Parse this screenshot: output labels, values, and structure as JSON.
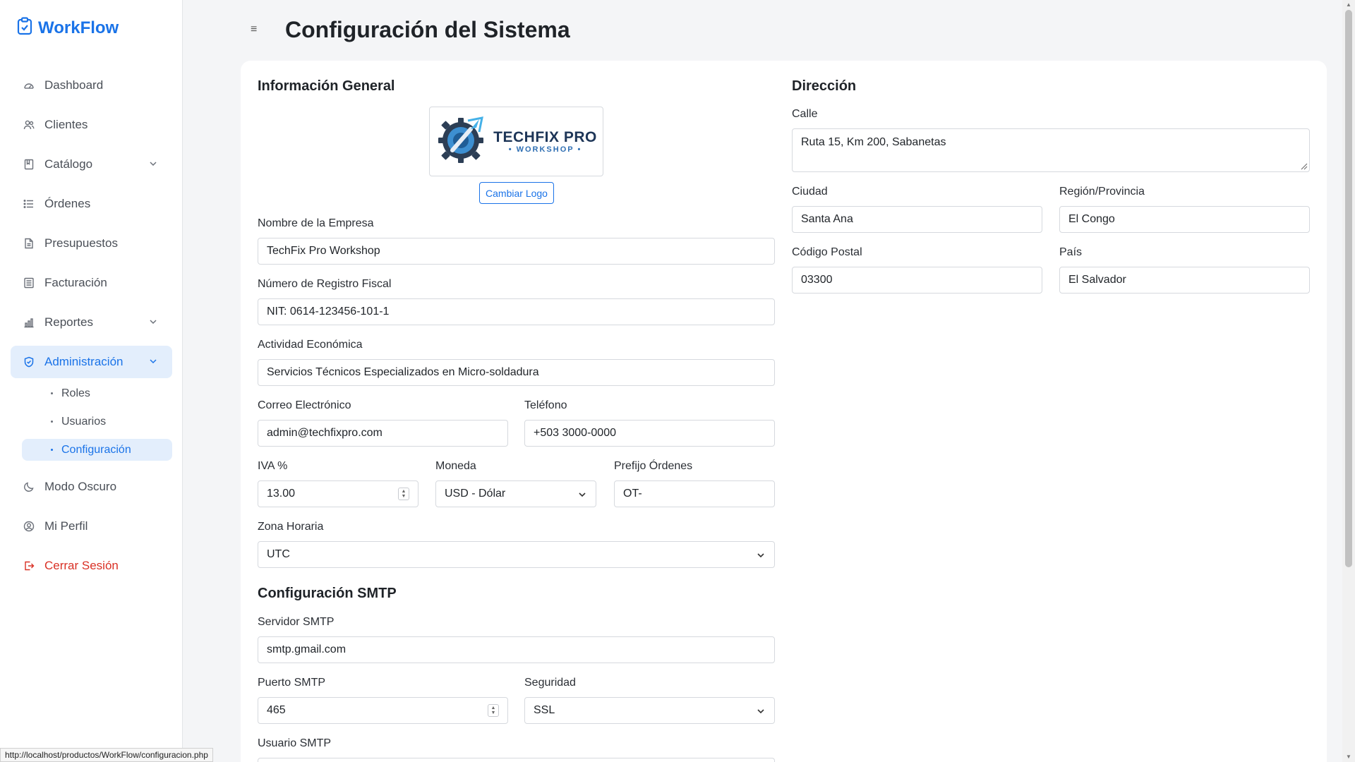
{
  "brand": {
    "name": "WorkFlow"
  },
  "nav": {
    "dashboard": "Dashboard",
    "clientes": "Clientes",
    "catalogo": "Catálogo",
    "ordenes": "Órdenes",
    "presupuestos": "Presupuestos",
    "facturacion": "Facturación",
    "reportes": "Reportes",
    "administracion": "Administración",
    "sub": {
      "roles": "Roles",
      "usuarios": "Usuarios",
      "configuracion": "Configuración"
    },
    "modo_oscuro": "Modo Oscuro",
    "mi_perfil": "Mi Perfil",
    "cerrar_sesion": "Cerrar Sesión"
  },
  "header": {
    "menu_icon": "≡",
    "title": "Configuración del Sistema"
  },
  "general": {
    "title": "Información General",
    "logo": {
      "main": "TECHFIX PRO",
      "sub": "• WORKSHOP •"
    },
    "change_logo": "Cambiar Logo",
    "company_label": "Nombre de la Empresa",
    "company_value": "TechFix Pro Workshop",
    "tax_label": "Número de Registro Fiscal",
    "tax_value": "NIT: 0614-123456-101-1",
    "activity_label": "Actividad Económica",
    "activity_value": "Servicios Técnicos Especializados en Micro-soldadura",
    "email_label": "Correo Electrónico",
    "email_value": "admin@techfixpro.com",
    "phone_label": "Teléfono",
    "phone_value": "+503 3000-0000",
    "iva_label": "IVA %",
    "iva_value": "13.00",
    "currency_label": "Moneda",
    "currency_value": "USD - Dólar",
    "prefix_label": "Prefijo Órdenes",
    "prefix_value": "OT-",
    "tz_label": "Zona Horaria",
    "tz_value": "UTC"
  },
  "smtp": {
    "title": "Configuración SMTP",
    "server_label": "Servidor SMTP",
    "server_value": "smtp.gmail.com",
    "port_label": "Puerto SMTP",
    "port_value": "465",
    "security_label": "Seguridad",
    "security_value": "SSL",
    "user_label": "Usuario SMTP"
  },
  "address": {
    "title": "Dirección",
    "street_label": "Calle",
    "street_value": "Ruta 15, Km 200, Sabanetas",
    "city_label": "Ciudad",
    "city_value": "Santa Ana",
    "region_label": "Región/Provincia",
    "region_value": "El Congo",
    "postal_label": "Código Postal",
    "postal_value": "03300",
    "country_label": "País",
    "country_value": "El Salvador"
  },
  "status_bar": {
    "url": "http://localhost/productos/WorkFlow/configuracion.php"
  },
  "colors": {
    "accent": "#1a73e8",
    "danger": "#d93025",
    "active_bg": "#e3eefc"
  }
}
